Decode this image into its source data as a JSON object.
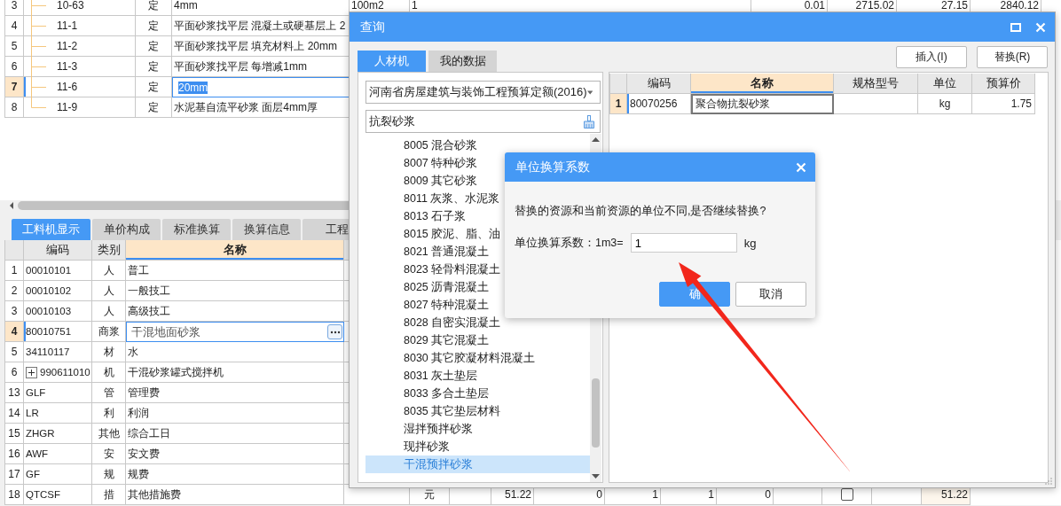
{
  "main_table": {
    "rows": [
      {
        "number": "3",
        "code": "10-63",
        "type": "定",
        "name": "4mm",
        "kind": "middle",
        "selected": false,
        "editing": false,
        "cells": [
          "100m2",
          "1",
          "0.01",
          "2715.02",
          "27.15",
          "2840.12"
        ]
      },
      {
        "number": "4",
        "code": "11-1",
        "type": "定",
        "name": "平面砂浆找平层 混凝土或硬基层上 2",
        "kind": "middle",
        "selected": false,
        "editing": false
      },
      {
        "number": "5",
        "code": "11-2",
        "type": "定",
        "name": "平面砂浆找平层 填充材料上 20mm",
        "kind": "middle",
        "selected": false,
        "editing": false
      },
      {
        "number": "6",
        "code": "11-3",
        "type": "定",
        "name": "平面砂浆找平层 每增减1mm",
        "kind": "middle",
        "selected": false,
        "editing": false
      },
      {
        "number": "7",
        "code": "11-6",
        "type": "定",
        "name": "20mm",
        "kind": "middle",
        "selected": true,
        "editing": true
      },
      {
        "number": "8",
        "code": "11-9",
        "type": "定",
        "name": "水泥基自流平砂浆 面层4mm厚",
        "kind": "last",
        "selected": false,
        "editing": false
      }
    ]
  },
  "detail_tabs": [
    {
      "label": "工料机显示",
      "selected": true
    },
    {
      "label": "单价构成",
      "selected": false
    },
    {
      "label": "标准换算",
      "selected": false
    },
    {
      "label": "换算信息",
      "selected": false
    },
    {
      "label": "工程",
      "selected": false
    }
  ],
  "resource_table": {
    "columns": [
      {
        "label": "编码",
        "selected": false
      },
      {
        "label": "类别",
        "selected": false
      },
      {
        "label": "名称",
        "selected": true
      }
    ],
    "rows": [
      {
        "number": "1",
        "code": "00010101",
        "type": "人",
        "name": "普工",
        "selected": false
      },
      {
        "number": "2",
        "code": "00010102",
        "type": "人",
        "name": "一般技工",
        "selected": false
      },
      {
        "number": "3",
        "code": "00010103",
        "type": "人",
        "name": "高级技工",
        "selected": false
      },
      {
        "number": "4",
        "code": "80010751",
        "type": "商浆",
        "name": "干混地面砂浆",
        "selected": true
      },
      {
        "number": "5",
        "code": "34110117",
        "type": "材",
        "name": "水",
        "selected": false
      },
      {
        "number": "6",
        "code": "990611010",
        "type": "机",
        "name": "干混砂浆罐式搅拌机",
        "selected": false,
        "expanded": false
      },
      {
        "number": "13",
        "code": "GLF",
        "type": "管",
        "name": "管理费",
        "selected": false
      },
      {
        "number": "14",
        "code": "LR",
        "type": "利",
        "name": "利润",
        "selected": false
      },
      {
        "number": "15",
        "code": "ZHGR",
        "type": "其他",
        "name": "综合工日",
        "selected": false
      },
      {
        "number": "16",
        "code": "AWF",
        "type": "安",
        "name": "安文费",
        "selected": false
      },
      {
        "number": "17",
        "code": "GF",
        "type": "规",
        "name": "规费",
        "selected": false
      },
      {
        "number": "18",
        "code": "QTCSF",
        "type": "措",
        "name": "其他措施费",
        "selected": false,
        "cells": [
          {
            "kind": "blank"
          },
          {
            "kind": "text",
            "value": "元"
          },
          {
            "kind": "blank"
          },
          {
            "kind": "text",
            "value": "51.22"
          },
          {
            "kind": "text",
            "value": "0"
          },
          {
            "kind": "text",
            "value": "1"
          },
          {
            "kind": "text",
            "value": "1"
          },
          {
            "kind": "text",
            "value": "0"
          },
          {
            "kind": "blank"
          },
          {
            "kind": "checkbox",
            "checked": false
          },
          {
            "kind": "blank"
          },
          {
            "kind": "text",
            "value": "51.22"
          }
        ]
      }
    ]
  },
  "query_dialog": {
    "title": "查询",
    "tabs": [
      {
        "label": "人材机",
        "selected": true
      },
      {
        "label": "我的数据",
        "selected": false
      }
    ],
    "buttons": [
      "插入(I)",
      "替换(R)"
    ],
    "quota_select": {
      "value": "河南省房屋建筑与装饰工程预算定额(2016)"
    },
    "search": {
      "value": "抗裂砂浆"
    },
    "tree": [
      {
        "label": "8005 混合砂浆",
        "selected": false
      },
      {
        "label": "8007 特种砂浆",
        "selected": false
      },
      {
        "label": "8009 其它砂浆",
        "selected": false
      },
      {
        "label": "8011 灰浆、水泥浆",
        "selected": false
      },
      {
        "label": "8013 石子浆",
        "selected": false
      },
      {
        "label": "8015 胶泥、脂、油",
        "selected": false
      },
      {
        "label": "8021 普通混凝土",
        "selected": false
      },
      {
        "label": "8023 轻骨料混凝土",
        "selected": false
      },
      {
        "label": "8025 沥青混凝土",
        "selected": false
      },
      {
        "label": "8027 特种混凝土",
        "selected": false
      },
      {
        "label": "8028 自密实混凝土",
        "selected": false
      },
      {
        "label": "8029 其它混凝土",
        "selected": false
      },
      {
        "label": "8030 其它胶凝材料混凝土",
        "selected": false
      },
      {
        "label": "8031 灰土垫层",
        "selected": false
      },
      {
        "label": "8033 多合土垫层",
        "selected": false
      },
      {
        "label": "8035 其它垫层材料",
        "selected": false
      },
      {
        "label": "湿拌预拌砂浆",
        "selected": false
      },
      {
        "label": "现拌砂浆",
        "selected": false
      },
      {
        "label": "干混预拌砂浆",
        "selected": true
      }
    ],
    "result_table": {
      "columns": [
        {
          "label": "编码",
          "selected": false
        },
        {
          "label": "名称",
          "selected": true
        },
        {
          "label": "规格型号",
          "selected": false
        },
        {
          "label": "单位",
          "selected": false
        },
        {
          "label": "预算价",
          "selected": false
        }
      ],
      "rows": [
        {
          "number": "1",
          "code": "80070256",
          "name": "聚合物抗裂砂浆",
          "unit": "kg",
          "price": "1.75",
          "selected": true
        }
      ]
    }
  },
  "unit_dialog": {
    "title": "单位换算系数",
    "message": "替换的资源和当前资源的单位不同,是否继续替换?",
    "factor_label": "单位换算系数：1m3=",
    "factor_value": "1",
    "unit": "kg",
    "buttons": [
      {
        "label": "确",
        "kind": "primary"
      },
      {
        "label": "取消",
        "kind": "default"
      }
    ]
  }
}
